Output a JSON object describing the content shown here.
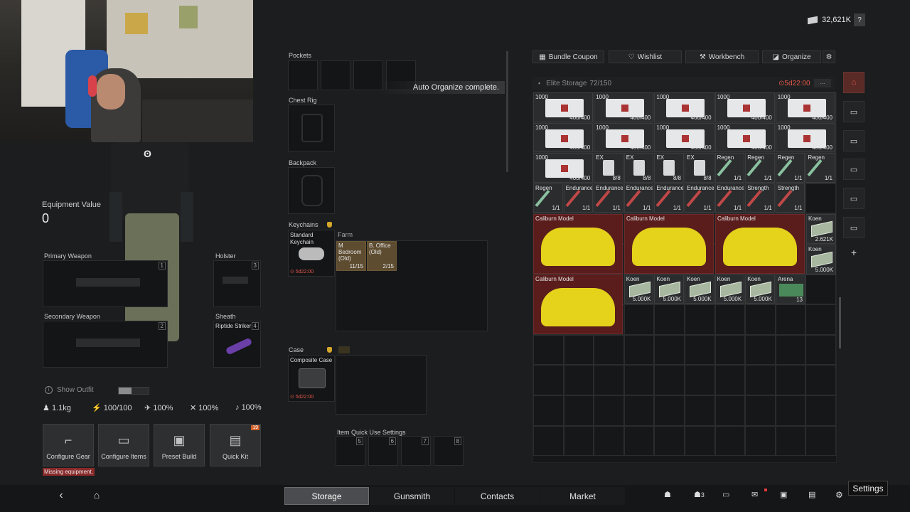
{
  "header": {
    "currency_value": "32,621K",
    "help_label": "?"
  },
  "equipment": {
    "equipment_value_label": "Equipment Value",
    "equipment_value": "0",
    "primary_weapon_label": "Primary Weapon",
    "primary_weapon_slot": "1",
    "secondary_weapon_label": "Secondary Weapon",
    "secondary_weapon_slot": "2",
    "holster_label": "Holster",
    "holster_slot": "3",
    "sheath_label": "Sheath",
    "sheath_item": "Riptide Striker",
    "sheath_slot": "4",
    "show_outfit_label": "Show Outfit",
    "stats": {
      "weight": "1.1kg",
      "stamina": "100/100",
      "s1": "100%",
      "s2": "100%",
      "s3": "100%"
    },
    "buttons": {
      "configure_gear": "Configure Gear",
      "configure_items": "Configure Items",
      "preset_build": "Preset Build",
      "quick_kit": "Quick Kit",
      "quick_kit_badge": "19"
    },
    "missing_equipment": "Missing equipment."
  },
  "loadout": {
    "pockets_label": "Pockets",
    "chest_rig_label": "Chest Rig",
    "backpack_label": "Backpack",
    "keychains_label": "Keychains",
    "keychain_item": "Standard Keychain",
    "keychain_timer": "5d22:00",
    "farm_label": "Farm",
    "key1_name": "M Bedroom (Old)",
    "key1_count": "11/15",
    "key2_name": "B. Office (Old)",
    "key2_count": "2/15",
    "case_label": "Case",
    "case_item": "Composite Case",
    "case_timer": "5d22:00",
    "quick_use_label": "Item Quick Use Settings",
    "quick_slots": [
      "5",
      "6",
      "7",
      "8"
    ],
    "toast": "Auto Organize complete."
  },
  "storage": {
    "toolbar": {
      "bundle_coupon": "Bundle Coupon",
      "wishlist": "Wishlist",
      "workbench": "Workbench",
      "organize": "Organize"
    },
    "title": "Elite Storage",
    "capacity": "72/150",
    "timer": "5d22:00",
    "more": "...",
    "medkit_label": "1000",
    "medkit_count": "400/400",
    "items_row3": [
      {
        "name": "EX",
        "count": "8/8"
      },
      {
        "name": "EX",
        "count": "8/8"
      },
      {
        "name": "EX",
        "count": "8/8"
      },
      {
        "name": "EX",
        "count": "8/8"
      },
      {
        "name": "Regen",
        "count": "1/1"
      },
      {
        "name": "Regen",
        "count": "1/1"
      },
      {
        "name": "Regen",
        "count": "1/1"
      },
      {
        "name": "Regen",
        "count": "1/1"
      }
    ],
    "items_row4": [
      {
        "name": "Regen",
        "count": "1/1"
      },
      {
        "name": "Endurance",
        "count": "1/1"
      },
      {
        "name": "Endurance",
        "count": "1/1"
      },
      {
        "name": "Endurance",
        "count": "1/1"
      },
      {
        "name": "Endurance",
        "count": "1/1"
      },
      {
        "name": "Endurance",
        "count": "1/1"
      },
      {
        "name": "Endurance",
        "count": "1/1"
      },
      {
        "name": "Strength",
        "count": "1/1"
      },
      {
        "name": "Strength",
        "count": "1/1"
      }
    ],
    "car_label": "Caliburn Model",
    "koen_label": "Koen",
    "koen_a": "2.621K",
    "koen_b": "5.000K",
    "koen_row": [
      "5.000K",
      "5.000K",
      "5.000K",
      "5.000K",
      "5.000K"
    ],
    "arena_label": "Arena",
    "arena_count": "13"
  },
  "nav": {
    "storage": "Storage",
    "gunsmith": "Gunsmith",
    "contacts": "Contacts",
    "market": "Market",
    "friends_count": "3",
    "settings_tooltip": "Settings"
  },
  "colors": {
    "accent_red": "#e2574c",
    "car_yellow": "#e4d21b",
    "bg": "#1b1d1e"
  }
}
